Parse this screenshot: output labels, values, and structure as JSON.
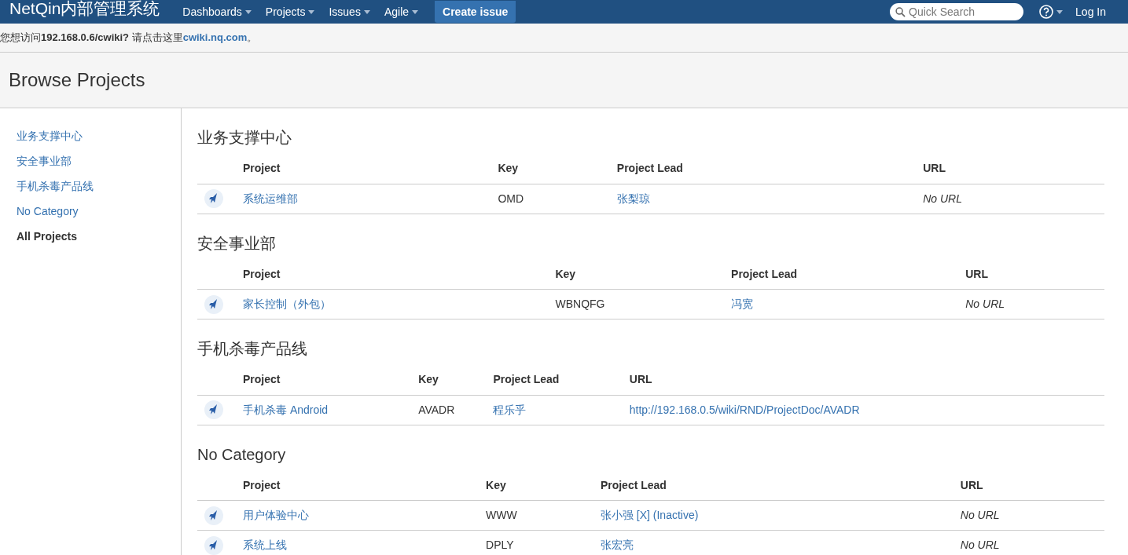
{
  "header": {
    "logo": "NetQin内部管理系统",
    "menus": [
      {
        "label": "Dashboards"
      },
      {
        "label": "Projects"
      },
      {
        "label": "Issues"
      },
      {
        "label": "Agile"
      }
    ],
    "create_button": "Create issue",
    "search": {
      "placeholder": "Quick Search"
    },
    "login": "Log In"
  },
  "notice": {
    "text": "您想访问**192.168.0.6/cwiki?** 请点击这里",
    "link": "cwiki.nq.com",
    "suffix": "。"
  },
  "page_title": "Browse Projects",
  "sidebar": {
    "items": [
      {
        "label": "业务支撑中心",
        "selected": false
      },
      {
        "label": "安全事业部",
        "selected": false
      },
      {
        "label": "手机杀毒产品线",
        "selected": false
      },
      {
        "label": "No Category",
        "selected": false
      },
      {
        "label": "All Projects",
        "selected": true
      }
    ]
  },
  "categories": [
    {
      "name": "业务支撑中心",
      "columns": [
        "Project",
        "Key",
        "Project Lead",
        "URL"
      ],
      "rows": [
        {
          "project": "系统运维部",
          "key": "OMD",
          "lead": "张梨琼",
          "url": "No URL",
          "has_url": false
        }
      ]
    },
    {
      "name": "安全事业部",
      "columns": [
        "Project",
        "Key",
        "Project Lead",
        "URL"
      ],
      "rows": [
        {
          "project": "家长控制（外包）",
          "key": "WBNQFG",
          "lead": "冯宽",
          "url": "No URL",
          "has_url": false
        }
      ]
    },
    {
      "name": "手机杀毒产品线",
      "columns": [
        "Project",
        "Key",
        "Project Lead",
        "URL"
      ],
      "rows": [
        {
          "project": "手机杀毒 Android",
          "key": "AVADR",
          "lead": "程乐乎",
          "url": "http://192.168.0.5/wiki/RND/ProjectDoc/AVADR",
          "has_url": true
        }
      ]
    },
    {
      "name": "No Category",
      "columns": [
        "Project",
        "Key",
        "Project Lead",
        "URL"
      ],
      "rows": [
        {
          "project": "用户体验中心",
          "key": "WWW",
          "lead": "张小强 [X] (Inactive)",
          "url": "No URL",
          "has_url": false
        },
        {
          "project": "系统上线",
          "key": "DPLY",
          "lead": "张宏亮",
          "url": "No URL",
          "has_url": false
        }
      ]
    }
  ]
}
